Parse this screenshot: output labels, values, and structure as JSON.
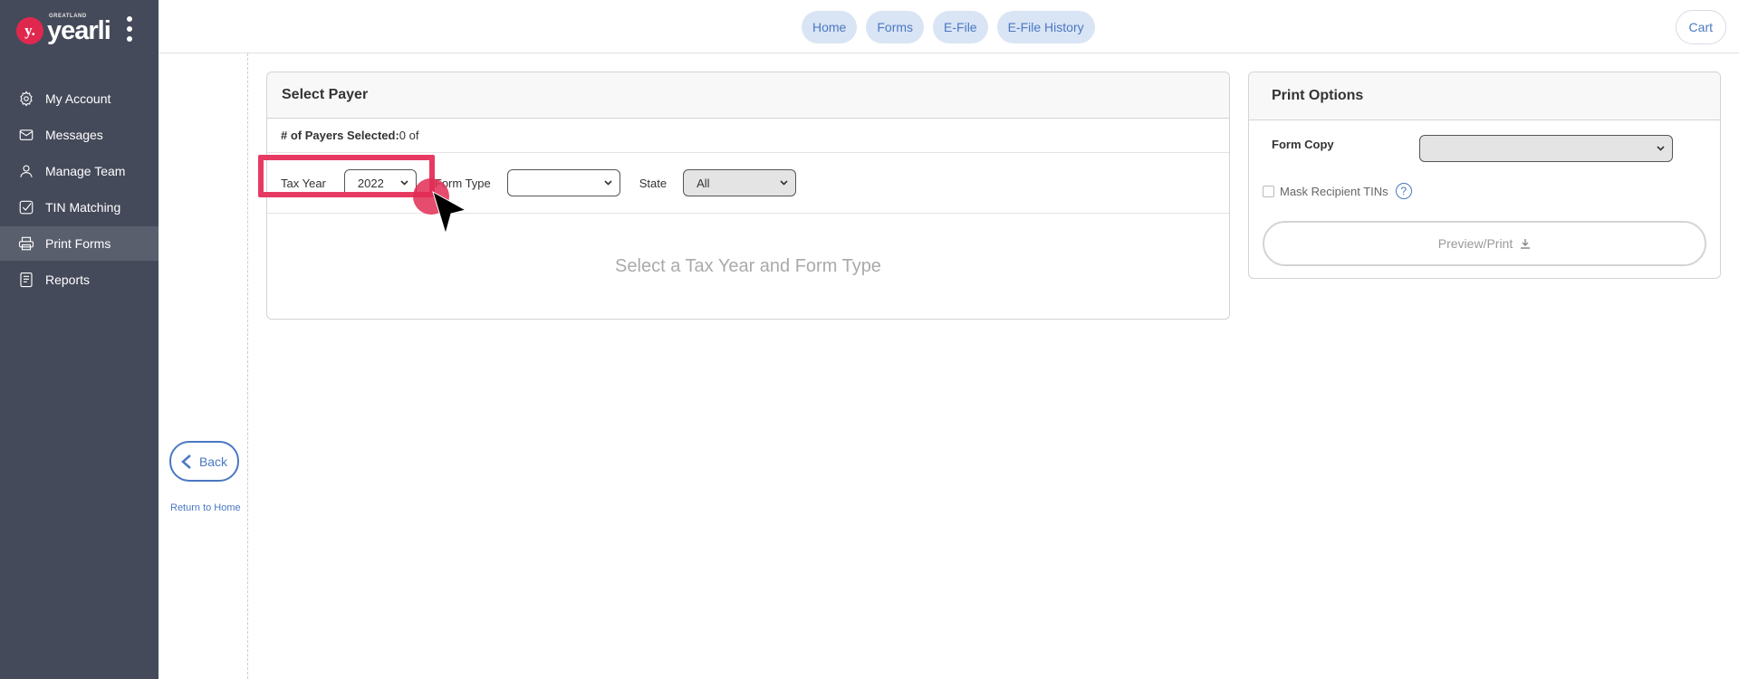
{
  "brand": {
    "logo_mark": "y.",
    "logo_text": "yearli",
    "logo_sub": "GREATLAND"
  },
  "sidebar": {
    "items": [
      {
        "label": "My Account",
        "icon": "gear-icon"
      },
      {
        "label": "Messages",
        "icon": "envelope-icon"
      },
      {
        "label": "Manage Team",
        "icon": "user-icon"
      },
      {
        "label": "TIN Matching",
        "icon": "check-square-icon"
      },
      {
        "label": "Print Forms",
        "icon": "printer-icon",
        "active": true
      },
      {
        "label": "Reports",
        "icon": "document-icon"
      }
    ]
  },
  "topnav": {
    "home": "Home",
    "forms": "Forms",
    "efile": "E-File",
    "efile_history": "E-File History",
    "cart": "Cart"
  },
  "gutter": {
    "back": "Back",
    "return_home": "Return to Home"
  },
  "select_payer": {
    "title": "Select Payer",
    "count_label": "# of Payers Selected:",
    "count_value": "0 of",
    "tax_year_label": "Tax Year",
    "tax_year_value": "2022",
    "form_type_label": "Form Type",
    "form_type_value": "",
    "state_label": "State",
    "state_value": "All",
    "empty_message": "Select a Tax Year and Form Type"
  },
  "print_options": {
    "title": "Print Options",
    "form_copy_label": "Form Copy",
    "form_copy_value": "",
    "mask_label": "Mask Recipient TINs",
    "help_glyph": "?",
    "preview_label": "Preview/Print"
  },
  "colors": {
    "sidebar": "#454a5a",
    "accent": "#4a78c2",
    "highlight": "#e63a62"
  }
}
